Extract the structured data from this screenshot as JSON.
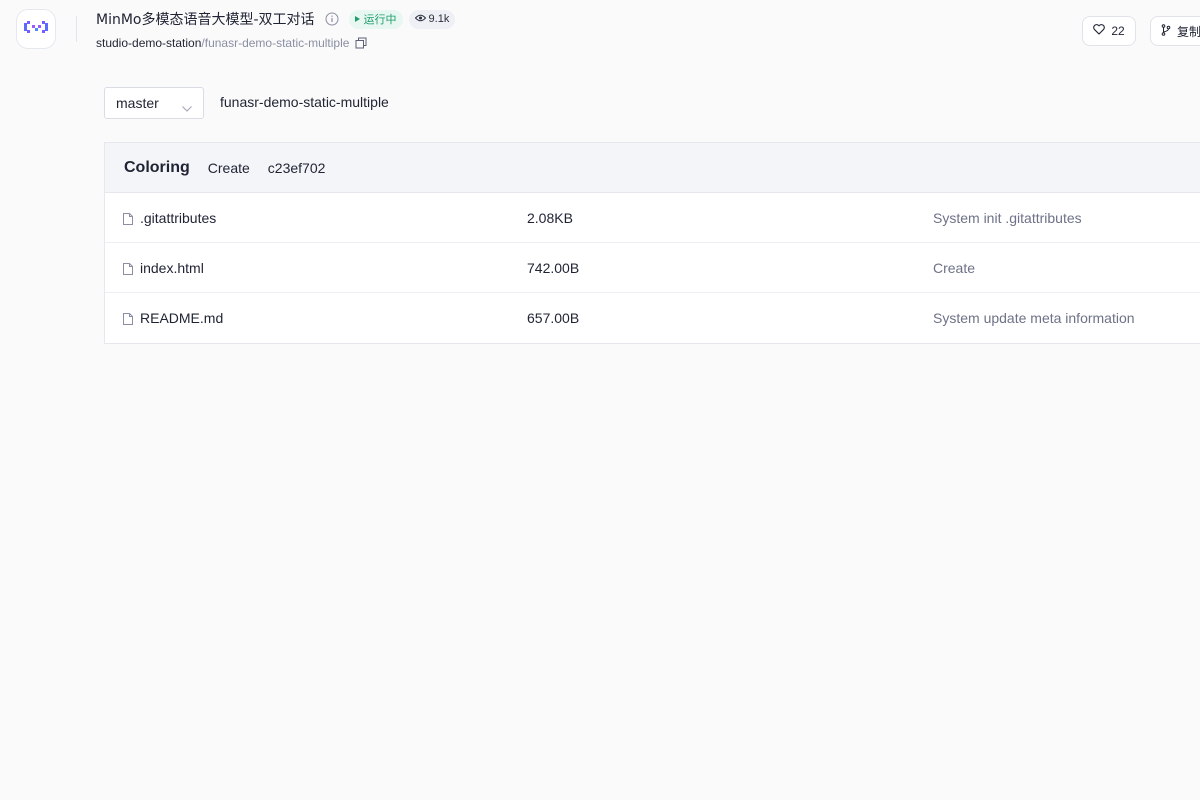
{
  "header": {
    "title": "MinMo多模态语音大模型-双工对话",
    "status": "运行中",
    "views": "9.1k",
    "owner": "studio-demo-station",
    "separator": "/",
    "repo": "funasr-demo-static-multiple",
    "likes": "22",
    "clone_label": "复制",
    "icons": [
      "logo-icon",
      "info-icon",
      "play-icon",
      "eye-icon",
      "copy-icon",
      "heart-icon",
      "branch-icon"
    ]
  },
  "branch": {
    "selected": "master",
    "repo_path": "funasr-demo-static-multiple"
  },
  "commit": {
    "author": "Coloring",
    "message": "Create",
    "hash": "c23ef702"
  },
  "files": [
    {
      "name": ".gitattributes",
      "size": "2.08KB",
      "commit": "System init .gitattributes"
    },
    {
      "name": "index.html",
      "size": "742.00B",
      "commit": "Create"
    },
    {
      "name": "README.md",
      "size": "657.00B",
      "commit": "System update meta information"
    }
  ],
  "colors": {
    "accent": "#624aff",
    "status_green": "#1f9d6b",
    "muted_text": "#6d7287"
  }
}
